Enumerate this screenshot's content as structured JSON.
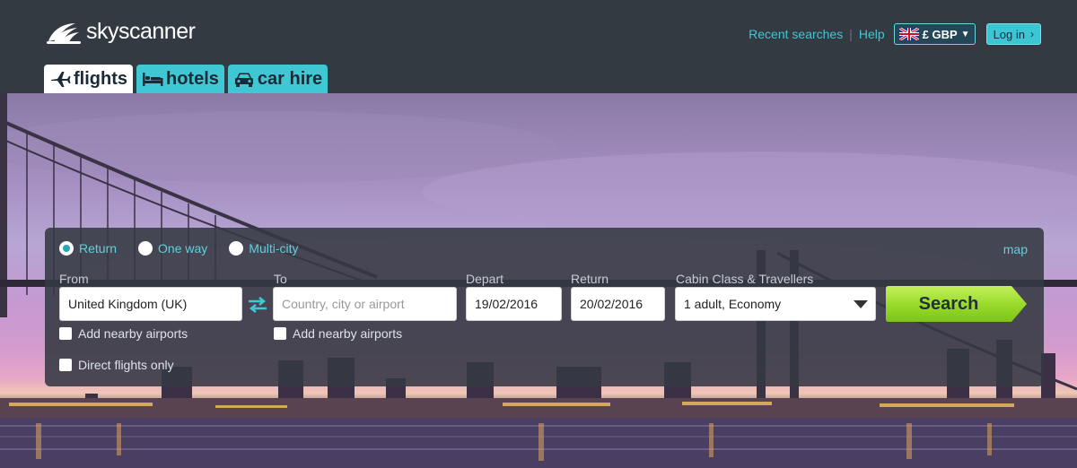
{
  "brand": {
    "name": "skyscanner"
  },
  "header": {
    "recent_searches": "Recent searches",
    "help": "Help",
    "currency": "£ GBP",
    "login": "Log in"
  },
  "tabs": [
    {
      "label": "flights",
      "icon": "plane-icon",
      "active": true
    },
    {
      "label": "hotels",
      "icon": "bed-icon",
      "active": false
    },
    {
      "label": "car hire",
      "icon": "car-icon",
      "active": false
    }
  ],
  "search": {
    "trip_types": [
      {
        "label": "Return",
        "selected": true
      },
      {
        "label": "One way",
        "selected": false
      },
      {
        "label": "Multi-city",
        "selected": false
      }
    ],
    "map_link": "map",
    "from_label": "From",
    "from_value": "United Kingdom (UK)",
    "to_label": "To",
    "to_placeholder": "Country, city or airport",
    "depart_label": "Depart",
    "depart_value": "19/02/2016",
    "return_label": "Return",
    "return_value": "20/02/2016",
    "cabin_label": "Cabin Class & Travellers",
    "cabin_value": "1 adult, Economy",
    "from_nearby": "Add nearby airports",
    "to_nearby": "Add nearby airports",
    "direct_only": "Direct flights only",
    "search_button": "Search"
  },
  "colors": {
    "accent": "#3fc8d4",
    "header_bg": "#343a42",
    "search_green": "#8fd12a"
  }
}
